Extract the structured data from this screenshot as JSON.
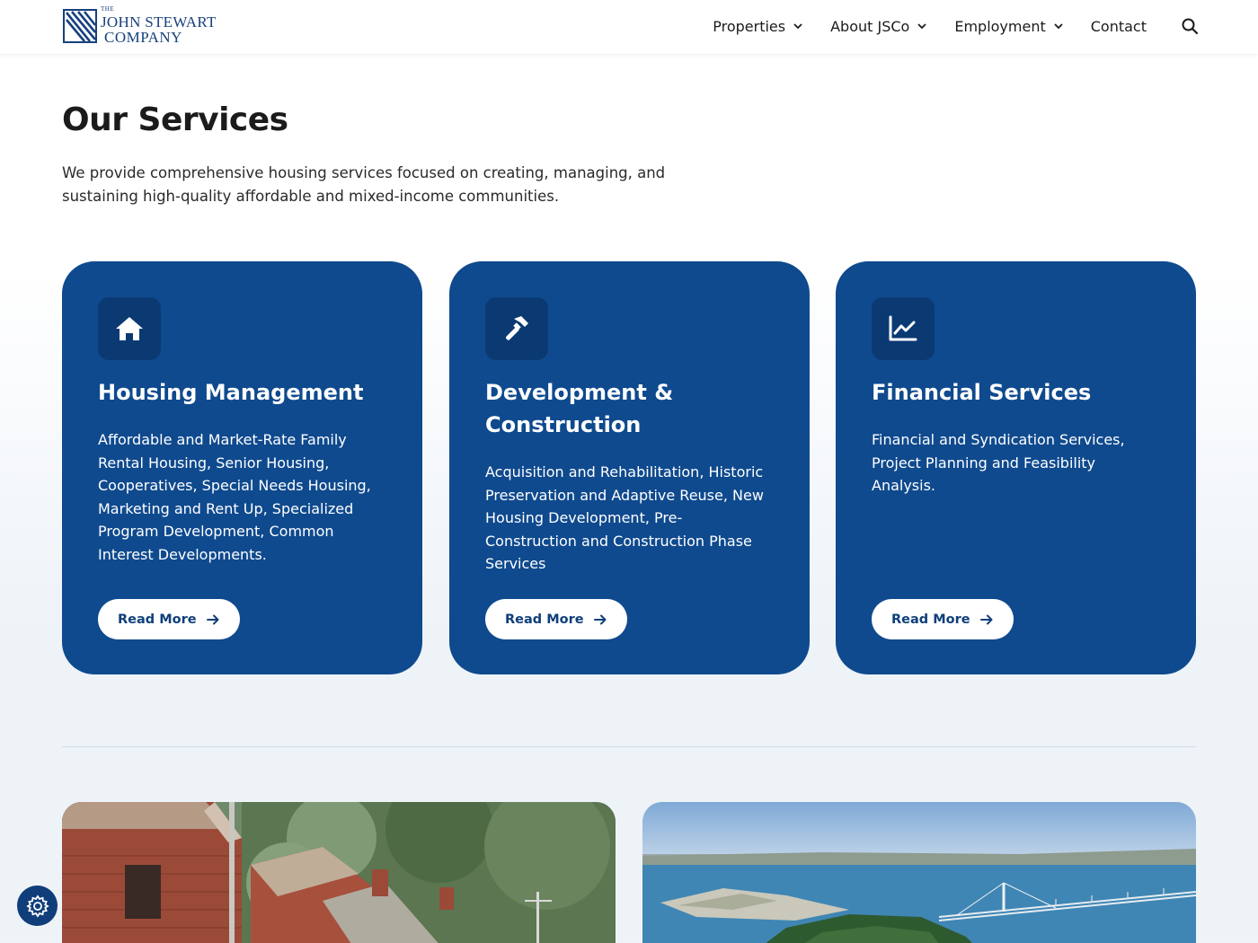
{
  "brand": {
    "logo_small": "THE",
    "logo_line1": "JOHN STEWART",
    "logo_line2": "COMPANY"
  },
  "nav": {
    "items": [
      {
        "label": "Properties",
        "dropdown": true
      },
      {
        "label": "About JSCo",
        "dropdown": true
      },
      {
        "label": "Employment",
        "dropdown": true
      },
      {
        "label": "Contact",
        "dropdown": false
      }
    ],
    "search_icon": "search-icon"
  },
  "services": {
    "title": "Our Services",
    "intro": "We provide comprehensive housing services focused on creating, managing, and sustaining high-quality affordable and mixed-income communities.",
    "cards": [
      {
        "icon": "home-icon",
        "title": "Housing Management",
        "description": "Affordable and Market-Rate Family Rental Housing, Senior Housing, Cooperatives, Special Needs Housing, Marketing and Rent Up, Specialized Program Development, Common Interest Developments.",
        "cta": "Read More"
      },
      {
        "icon": "hammer-icon",
        "title": "Development & Construction",
        "description": "Acquisition and Rehabilitation, Historic Preservation and Adaptive Reuse, New Housing Development, Pre-Construction and Construction Phase Services",
        "cta": "Read More"
      },
      {
        "icon": "chart-line-icon",
        "title": "Financial Services",
        "description": "Financial and Syndication Services, Project Planning and Feasibility Analysis.",
        "cta": "Read More"
      }
    ]
  },
  "colors": {
    "card_bg": "#0f4a8e",
    "icon_bg": "#0b3a73",
    "brand_blue": "#17407e"
  },
  "cookie_settings_icon": "gear-icon"
}
